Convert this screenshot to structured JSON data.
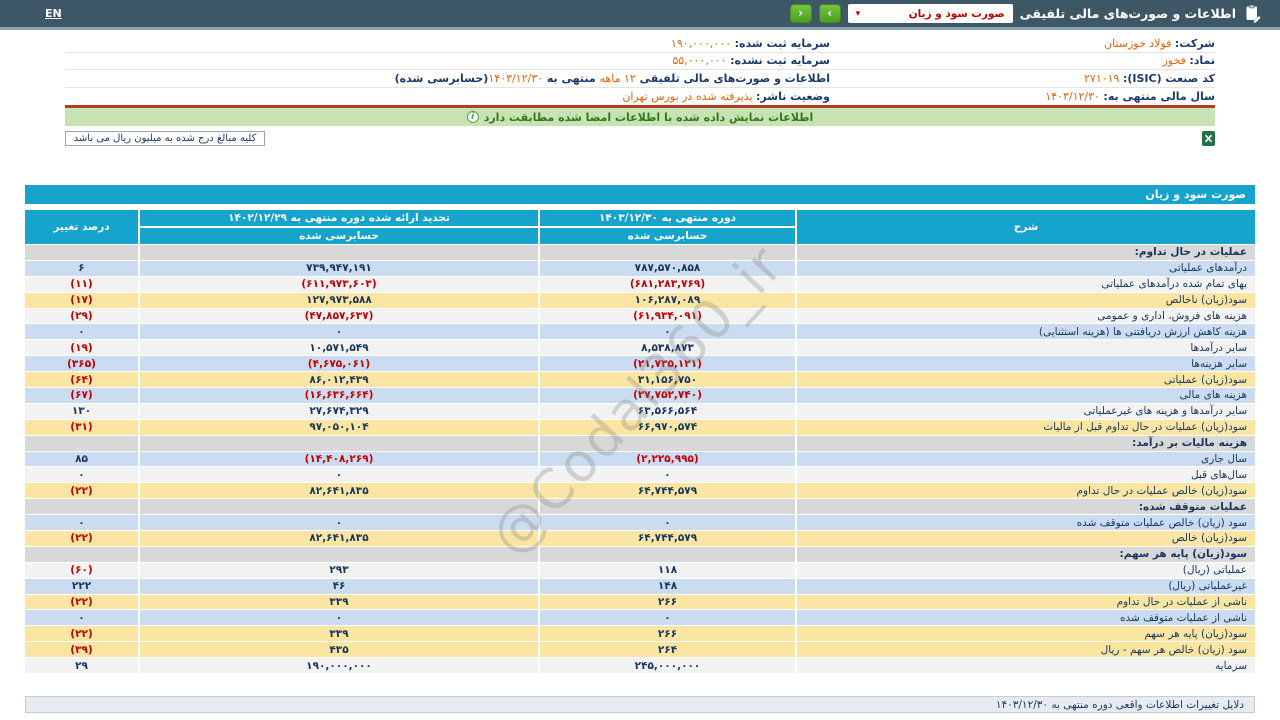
{
  "colors": {
    "navbar": "#3d5766",
    "accent_cyan": "#16a4cc",
    "highlight_yellow": "#fbe5a3",
    "row_blue": "#cbdcf0",
    "negative_red": "#c40000",
    "value_orange": "#e4640e",
    "banner_green": "#c7e3b3"
  },
  "navbar": {
    "language": "EN",
    "title": "اطلاعات و صورت‌های مالی تلفیقی",
    "dropdown_value": "صورت سود و زیان",
    "caret_icon": "▾",
    "next_label": "›",
    "prev_label": "‹"
  },
  "company": {
    "right": [
      {
        "label": "شرکت:",
        "value": "فولاد خوزستان"
      },
      {
        "label": "نماد:",
        "value": "فخوز"
      },
      {
        "label": "کد صنعت (ISIC):",
        "value": "۲۷۱۰۱۹"
      },
      {
        "label": "سال مالی منتهی به:",
        "value": "۱۴۰۳/۱۲/۳۰"
      }
    ],
    "left": [
      {
        "label": "سرمایه ثبت شده:",
        "value": "۱۹۰,۰۰۰,۰۰۰"
      },
      {
        "label": "سرمایه ثبت نشده:",
        "value": "۵۵,۰۰۰,۰۰۰"
      },
      {
        "parts": [
          "اطلاعات و صورت‌های مالی تلفیقی ",
          "۱۲ ماهه",
          " منتهی به ",
          "۱۴۰۳/۱۲/۳۰",
          "(حسابرسی شده)"
        ]
      },
      {
        "label": "وضعیت ناشر:",
        "value": "پذیرفته شده در بورس تهران"
      }
    ]
  },
  "banner": {
    "text": "اطلاعات نمایش داده شده با اطلاعات امضا شده مطابقت دارد"
  },
  "note": {
    "text": "کلیه مبالغ درج شده به میلیون ریال می باشد"
  },
  "statement": {
    "title": "صورت سود و زیان",
    "header": {
      "desc": "شرح",
      "current_title": "دوره منتهی به ۱۴۰۳/۱۲/۳۰",
      "current_sub": "حسابرسی شده",
      "prior_title": "تجدید ارائه شده دوره منتهی به ۱۴۰۲/۱۲/۲۹",
      "prior_sub": "حسابرسی شده",
      "change": "درصد تغییر"
    },
    "rows": [
      {
        "type": "section",
        "label": "عملیات در حال تداوم:"
      },
      {
        "type": "data",
        "style": "blue",
        "label": "درآمدهای عملیاتی",
        "current": "۷۸۷,۵۷۰,۸۵۸",
        "prior": "۷۳۹,۹۴۷,۱۹۱",
        "change": "۶"
      },
      {
        "type": "data",
        "style": "white",
        "label": "بهای تمام شده درآمدهای عملیاتی",
        "current": "(۶۸۱,۲۸۳,۷۶۹)",
        "prior": "(۶۱۱,۹۷۳,۶۰۳)",
        "change": "(۱۱)"
      },
      {
        "type": "data",
        "style": "yellow",
        "label": "سود(زیان) ناخالص",
        "current": "۱۰۶,۲۸۷,۰۸۹",
        "prior": "۱۲۷,۹۷۳,۵۸۸",
        "change": "(۱۷)"
      },
      {
        "type": "data",
        "style": "white",
        "label": "هزینه های فروش، اداری و عمومی",
        "current": "(۶۱,۹۳۴,۰۹۱)",
        "prior": "(۴۷,۸۵۷,۶۳۷)",
        "change": "(۲۹)"
      },
      {
        "type": "data",
        "style": "blue",
        "label": "هزینه کاهش ارزش دریافتنی ها (هزینه استثنایی)",
        "current": "۰",
        "prior": "۰",
        "change": "۰"
      },
      {
        "type": "data",
        "style": "white",
        "label": "سایر درآمدها",
        "current": "۸,۵۳۸,۸۷۳",
        "prior": "۱۰,۵۷۱,۵۴۹",
        "change": "(۱۹)"
      },
      {
        "type": "data",
        "style": "blue",
        "label": "سایر هزینه‌ها",
        "current": "(۲۱,۷۳۵,۱۲۱)",
        "prior": "(۴,۶۷۵,۰۶۱)",
        "change": "(۳۶۵)"
      },
      {
        "type": "data",
        "style": "yellow",
        "label": "سود(زیان) عملیاتی",
        "current": "۳۱,۱۵۶,۷۵۰",
        "prior": "۸۶,۰۱۲,۴۳۹",
        "change": "(۶۴)"
      },
      {
        "type": "data",
        "style": "blue",
        "label": "هزینه های مالی",
        "current": "(۲۷,۷۵۲,۷۴۰)",
        "prior": "(۱۶,۶۳۶,۶۶۴)",
        "change": "(۶۷)"
      },
      {
        "type": "data",
        "style": "white",
        "label": "سایر درآمدها و هزینه های غیرعملیاتی",
        "current": "۶۳,۵۶۶,۵۶۴",
        "prior": "۲۷,۶۷۴,۳۲۹",
        "change": "۱۳۰"
      },
      {
        "type": "data",
        "style": "yellow",
        "label": "سود(زیان) عملیات در حال تداوم قبل از مالیات",
        "current": "۶۶,۹۷۰,۵۷۴",
        "prior": "۹۷,۰۵۰,۱۰۴",
        "change": "(۳۱)"
      },
      {
        "type": "section",
        "label": "هزینه مالیات بر درآمد:"
      },
      {
        "type": "data",
        "style": "blue",
        "label": "سال جاری",
        "current": "(۲,۲۲۵,۹۹۵)",
        "prior": "(۱۴,۴۰۸,۲۶۹)",
        "change": "۸۵"
      },
      {
        "type": "data",
        "style": "white",
        "label": "سال‌های قبل",
        "current": "۰",
        "prior": "۰",
        "change": "۰"
      },
      {
        "type": "data",
        "style": "yellow",
        "label": "سود(زیان) خالص عملیات در حال تداوم",
        "current": "۶۴,۷۴۴,۵۷۹",
        "prior": "۸۲,۶۴۱,۸۳۵",
        "change": "(۲۲)"
      },
      {
        "type": "section",
        "label": "عملیات متوقف شده:"
      },
      {
        "type": "data",
        "style": "blue",
        "label": "سود (زیان) خالص عملیات متوقف شده",
        "current": "۰",
        "prior": "۰",
        "change": "۰"
      },
      {
        "type": "data",
        "style": "yellow",
        "label": "سود(زیان) خالص",
        "current": "۶۴,۷۴۴,۵۷۹",
        "prior": "۸۲,۶۴۱,۸۳۵",
        "change": "(۲۲)"
      },
      {
        "type": "section",
        "label": "سود(زیان) پایه هر سهم:"
      },
      {
        "type": "data",
        "style": "white",
        "label": "عملیاتی (ریال)",
        "current": "۱۱۸",
        "prior": "۲۹۳",
        "change": "(۶۰)"
      },
      {
        "type": "data",
        "style": "blue",
        "label": "غیرعملیاتی (ریال)",
        "current": "۱۴۸",
        "prior": "۴۶",
        "change": "۲۲۲"
      },
      {
        "type": "data",
        "style": "yellow",
        "label": "ناشی از عملیات در حال تداوم",
        "current": "۲۶۶",
        "prior": "۳۳۹",
        "change": "(۲۲)"
      },
      {
        "type": "data",
        "style": "blue",
        "label": "ناشی از عملیات متوقف شده",
        "current": "۰",
        "prior": "۰",
        "change": "۰"
      },
      {
        "type": "data",
        "style": "yellow",
        "label": "سود(زیان) پایه هر سهم",
        "current": "۲۶۶",
        "prior": "۳۳۹",
        "change": "(۲۲)"
      },
      {
        "type": "data",
        "style": "yellow",
        "label": "سود (زیان) خالص هر سهم - ریال",
        "current": "۲۶۴",
        "prior": "۴۳۵",
        "change": "(۳۹)"
      },
      {
        "type": "data",
        "style": "white",
        "label": "سرمایه",
        "current": "۲۴۵,۰۰۰,۰۰۰",
        "prior": "۱۹۰,۰۰۰,۰۰۰",
        "change": "۲۹"
      }
    ]
  },
  "footer": {
    "text": "دلایل تغییرات اطلاعات واقعی دوره منتهی به ۱۴۰۳/۱۲/۳۰"
  },
  "watermark": {
    "text": "@Codal360_ir"
  }
}
